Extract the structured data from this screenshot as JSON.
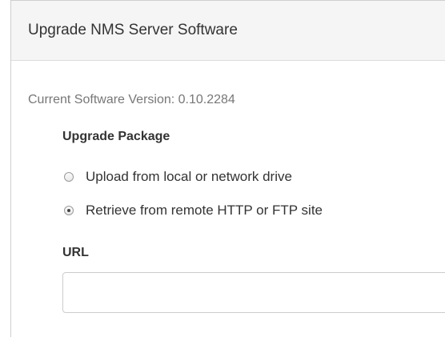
{
  "panel": {
    "title": "Upgrade NMS Server Software"
  },
  "version": {
    "text": "Current Software Version: 0.10.2284"
  },
  "upgrade_package": {
    "heading": "Upgrade Package",
    "options": [
      {
        "label": "Upload from local or network drive",
        "selected": false
      },
      {
        "label": "Retrieve from remote HTTP or FTP site",
        "selected": true
      }
    ]
  },
  "url": {
    "label": "URL",
    "value": ""
  }
}
